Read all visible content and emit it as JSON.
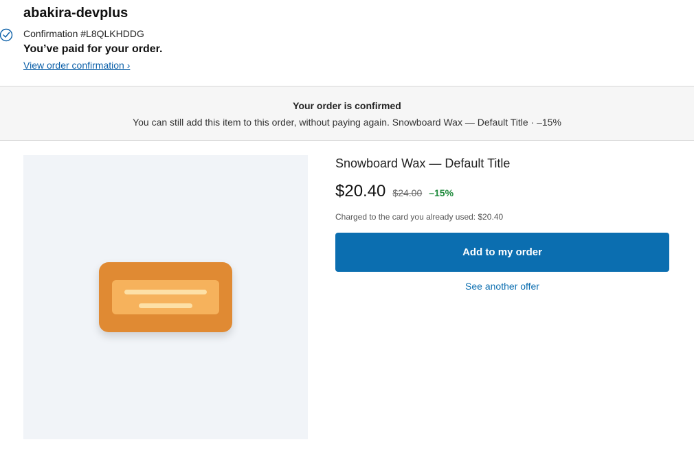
{
  "header": {
    "shop_name": "abakira-devplus",
    "confirmation_number": "Confirmation #L8QLKHDDG",
    "paid_message": "You’ve paid for your order.",
    "view_confirmation_link": "View order confirmation ›"
  },
  "banner": {
    "title": "Your order is confirmed",
    "subtitle": "You can still add this item to this order, without paying again. Snowboard Wax — Default Title · –15%"
  },
  "product": {
    "image_icon": "wax-block-icon",
    "title": "Snowboard Wax — Default Title",
    "price": "$20.40",
    "compare_price": "$24.00",
    "discount": "–15%",
    "charged_note": "Charged to the card you already used: $20.40",
    "add_button_label": "Add to my order",
    "another_offer_label": "See another offer"
  },
  "colors": {
    "accent": "#0b6eb0",
    "link": "#0b5fa8",
    "discount_green": "#1f8a3c",
    "wax_orange": "#e08a33"
  }
}
